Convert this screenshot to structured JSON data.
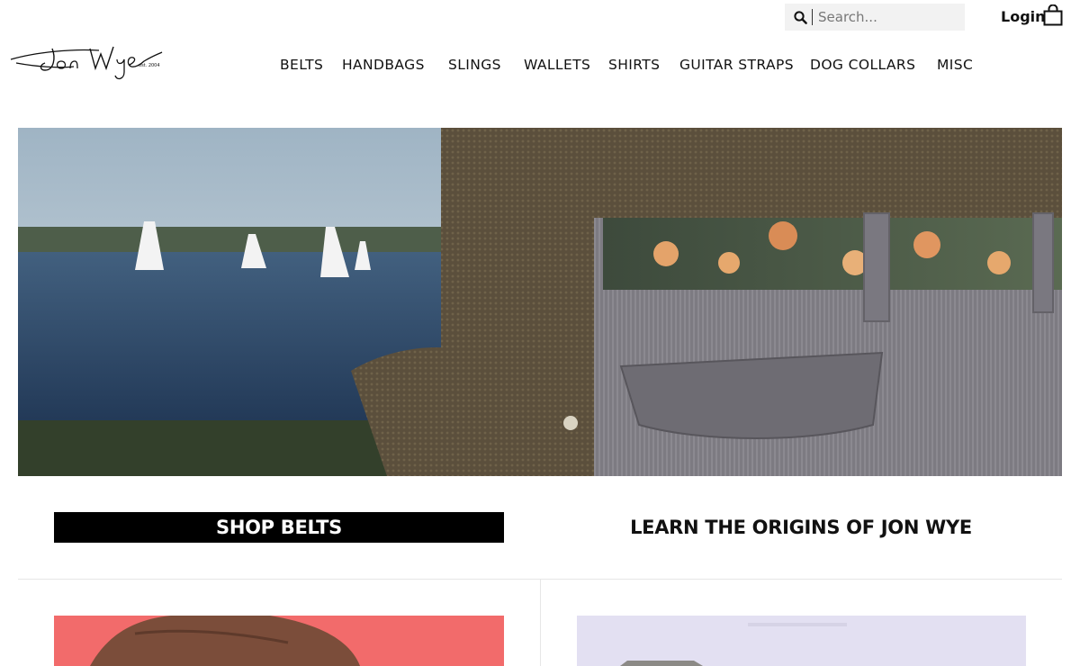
{
  "header": {
    "search_placeholder": "Search...",
    "login_label": "Login",
    "logo_text": "Jon Wye",
    "logo_est": "est. 2004"
  },
  "nav": {
    "items": [
      "BELTS",
      "HANDBAGS",
      "SLINGS",
      "WALLETS",
      "SHIRTS",
      "GUITAR STRAPS",
      "DOG COLLARS",
      "MISC"
    ]
  },
  "cta": {
    "shop_label": "SHOP BELTS",
    "learn_label": "LEARN THE ORIGINS OF JON WYE"
  },
  "colors": {
    "cta_background": "#000000",
    "tile_left_background": "#f26b6b",
    "tile_right_background": "#e3e0f2"
  },
  "icons": {
    "search": "search-icon",
    "cart": "shopping-bag-icon"
  }
}
